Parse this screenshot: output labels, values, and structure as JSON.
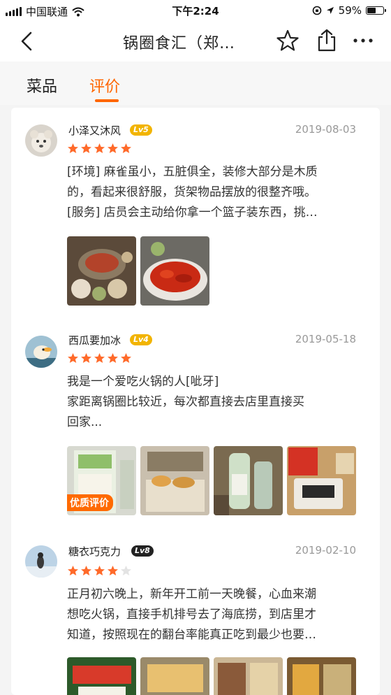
{
  "status_bar": {
    "carrier": "中国联通",
    "time": "下午2:24",
    "battery": "59%",
    "battery_level": 0.59
  },
  "header": {
    "title": "锅圈食汇（郑…"
  },
  "tabs": [
    {
      "label": "菜品",
      "active": false
    },
    {
      "label": "评价",
      "active": true
    }
  ],
  "reviews": [
    {
      "user": "小泽又沐风",
      "level": "Lv5",
      "level_color": "#f2b400",
      "date": "2019-08-03",
      "rating": 5,
      "text_lines": [
        "[环境] 麻雀虽小，五脏俱全，装修大部分是木质",
        "的，看起来很舒服，货架物品摆放的很整齐哦。",
        "[服务] 店员会主动给你拿一个篮子装东西，挑…"
      ],
      "photo_count": 2
    },
    {
      "user": "西瓜要加冰",
      "level": "Lv4",
      "level_color": "#f2b400",
      "date": "2019-05-18",
      "rating": 5,
      "text_lines": [
        "我是一个爱吃火锅的人[呲牙]",
        "家距离锅圈比较近，每次都直接去店里直接买",
        "回家..."
      ],
      "photo_count": 4,
      "photo_badge": "优质评价"
    },
    {
      "user": "糖衣巧克力",
      "level": "Lv8",
      "level_color": "#222222",
      "date": "2019-02-10",
      "rating": 4,
      "text_lines": [
        "正月初六晚上，新年开工前一天晚餐，心血来潮",
        "想吃火锅，直接手机排号去了海底捞，到店里才",
        "知道，按照现在的翻台率能真正吃到最少也要…"
      ],
      "photo_count": 4
    }
  ],
  "colors": {
    "accent": "#ff6600",
    "star": "#ff6a2a",
    "star_empty": "#e3e3e3"
  }
}
